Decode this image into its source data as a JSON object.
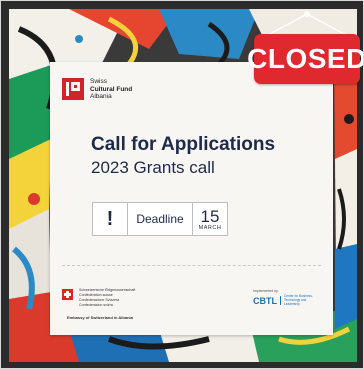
{
  "badge": {
    "closed_label": "CLOSED"
  },
  "org": {
    "logo_line1": "Swiss",
    "logo_line2": "Cultural Fund",
    "logo_line3": "Albania"
  },
  "card": {
    "title": "Call for Applications",
    "subtitle": "2023 Grants call",
    "excl": "!",
    "deadline_label": "Deadline",
    "deadline_day": "15",
    "deadline_month": "MARCH"
  },
  "footer": {
    "confed_lines": [
      "Schweizerische Eidgenossenschaft",
      "Confédération suisse",
      "Confederazione Svizzera",
      "Confederaziun svizra"
    ],
    "embassy": "Embassy of Switzerland in Albania",
    "implemented_by": "Implemented by",
    "cbtl_logo": "CBTL",
    "cbtl_tagline": "Center for Business, Technology and Leadership"
  },
  "colors": {
    "brand_red": "#d2232a",
    "title_navy": "#1e2a4a",
    "closed_red": "#e0292e",
    "cbtl_blue": "#1a72b8"
  }
}
